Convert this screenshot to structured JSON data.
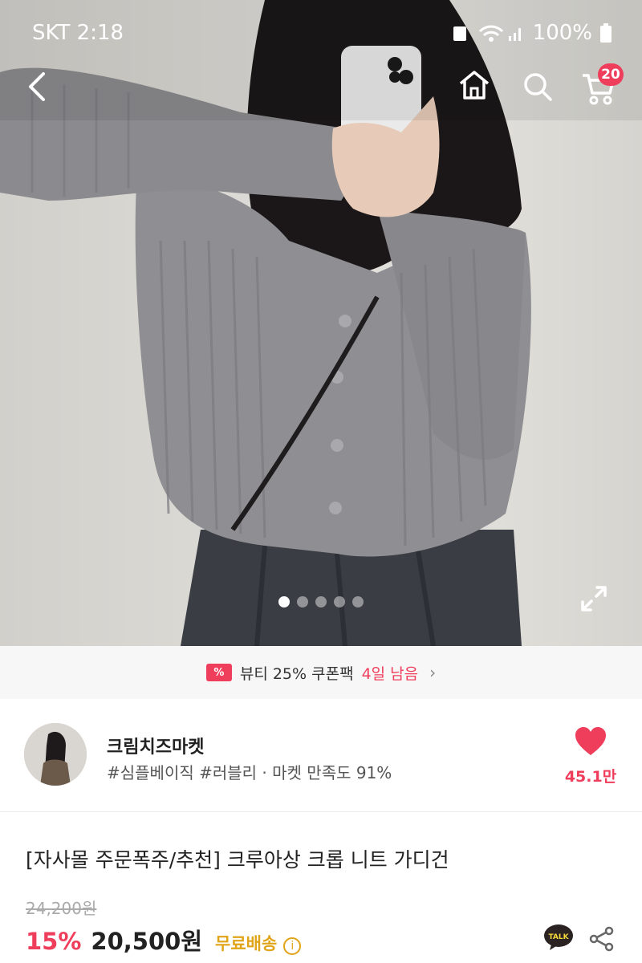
{
  "status_bar": {
    "carrier_time": "SKT 2:18",
    "battery": "100%"
  },
  "nav": {
    "cart_count": "20"
  },
  "gallery": {
    "total_images": 5,
    "active_index": 0
  },
  "coupon": {
    "text": "뷰티 25% 쿠폰팩",
    "days_left": "4일 남음"
  },
  "seller": {
    "name": "크림치즈마켓",
    "tags": "#심플베이직 #러블리 · 마켓 만족도 91%",
    "favorites": "45.1만"
  },
  "product": {
    "title": "[자사몰 주문폭주/추천] 크루아상 크롭 니트 가디건",
    "original_price": "24,200원",
    "discount": "15%",
    "price": "20,500원",
    "shipping": "무료배송"
  },
  "colors": {
    "accent": "#ef3e5c",
    "shipping": "#e0a418"
  },
  "icons": [
    "back-icon",
    "home-icon",
    "search-icon",
    "cart-icon",
    "expand-icon",
    "coupon-icon",
    "chevron-right-icon",
    "heart-icon",
    "info-icon",
    "kakaotalk-icon",
    "share-icon"
  ]
}
